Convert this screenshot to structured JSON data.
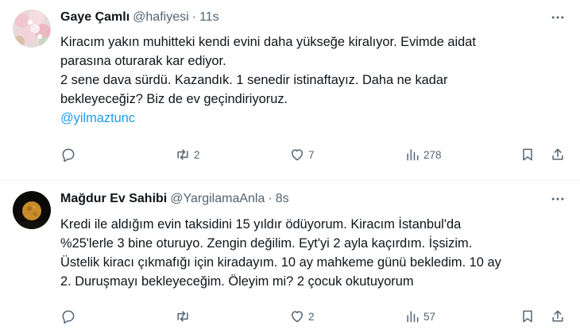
{
  "tweets": [
    {
      "author_name": "Gaye Çamlı",
      "handle": "@hafiyesi",
      "separator": "·",
      "time": "11s",
      "lines": [
        "Kiracım yakın muhitteki kendi evini daha yükseğe kiralıyor. Evimde aidat",
        "parasına oturarak kar ediyor.",
        "2 sene dava sürdü. Kazandık. 1 senedir istinaftayız. Daha ne kadar",
        "bekleyeceğiz? Biz de ev geçindiriyoruz."
      ],
      "mention": "@yilmaztunc",
      "retweets": "2",
      "likes": "7",
      "views": "278",
      "avatar_icon": "pink-blossom-avatar"
    },
    {
      "author_name": "Mağdur Ev Sahibi",
      "handle": "@YargilamaAnla",
      "separator": "·",
      "time": "8s",
      "lines": [
        "Kredi ile aldığım evin taksidini 15 yıldır ödüyorum. Kiracım İstanbul'da",
        "%25'lerle 3 bine oturuyo. Zengin değilim. Eyt'yi 2 ayla kaçırdım. İşsizim.",
        "Üstelik kiracı çıkmafığı için kiradayım. 10 ay mahkeme günü bekledim. 10 ay",
        "2. Duruşmayı bekleyeceğim. Öleyim mi? 2 çocuk okutuyorum"
      ],
      "retweets": "",
      "likes": "2",
      "views": "57",
      "avatar_icon": "moon-night-avatar"
    }
  ],
  "colors": {
    "text": "#0f1419",
    "secondary": "#536471",
    "link": "#1d9bf0",
    "divider": "#eff3f4"
  }
}
